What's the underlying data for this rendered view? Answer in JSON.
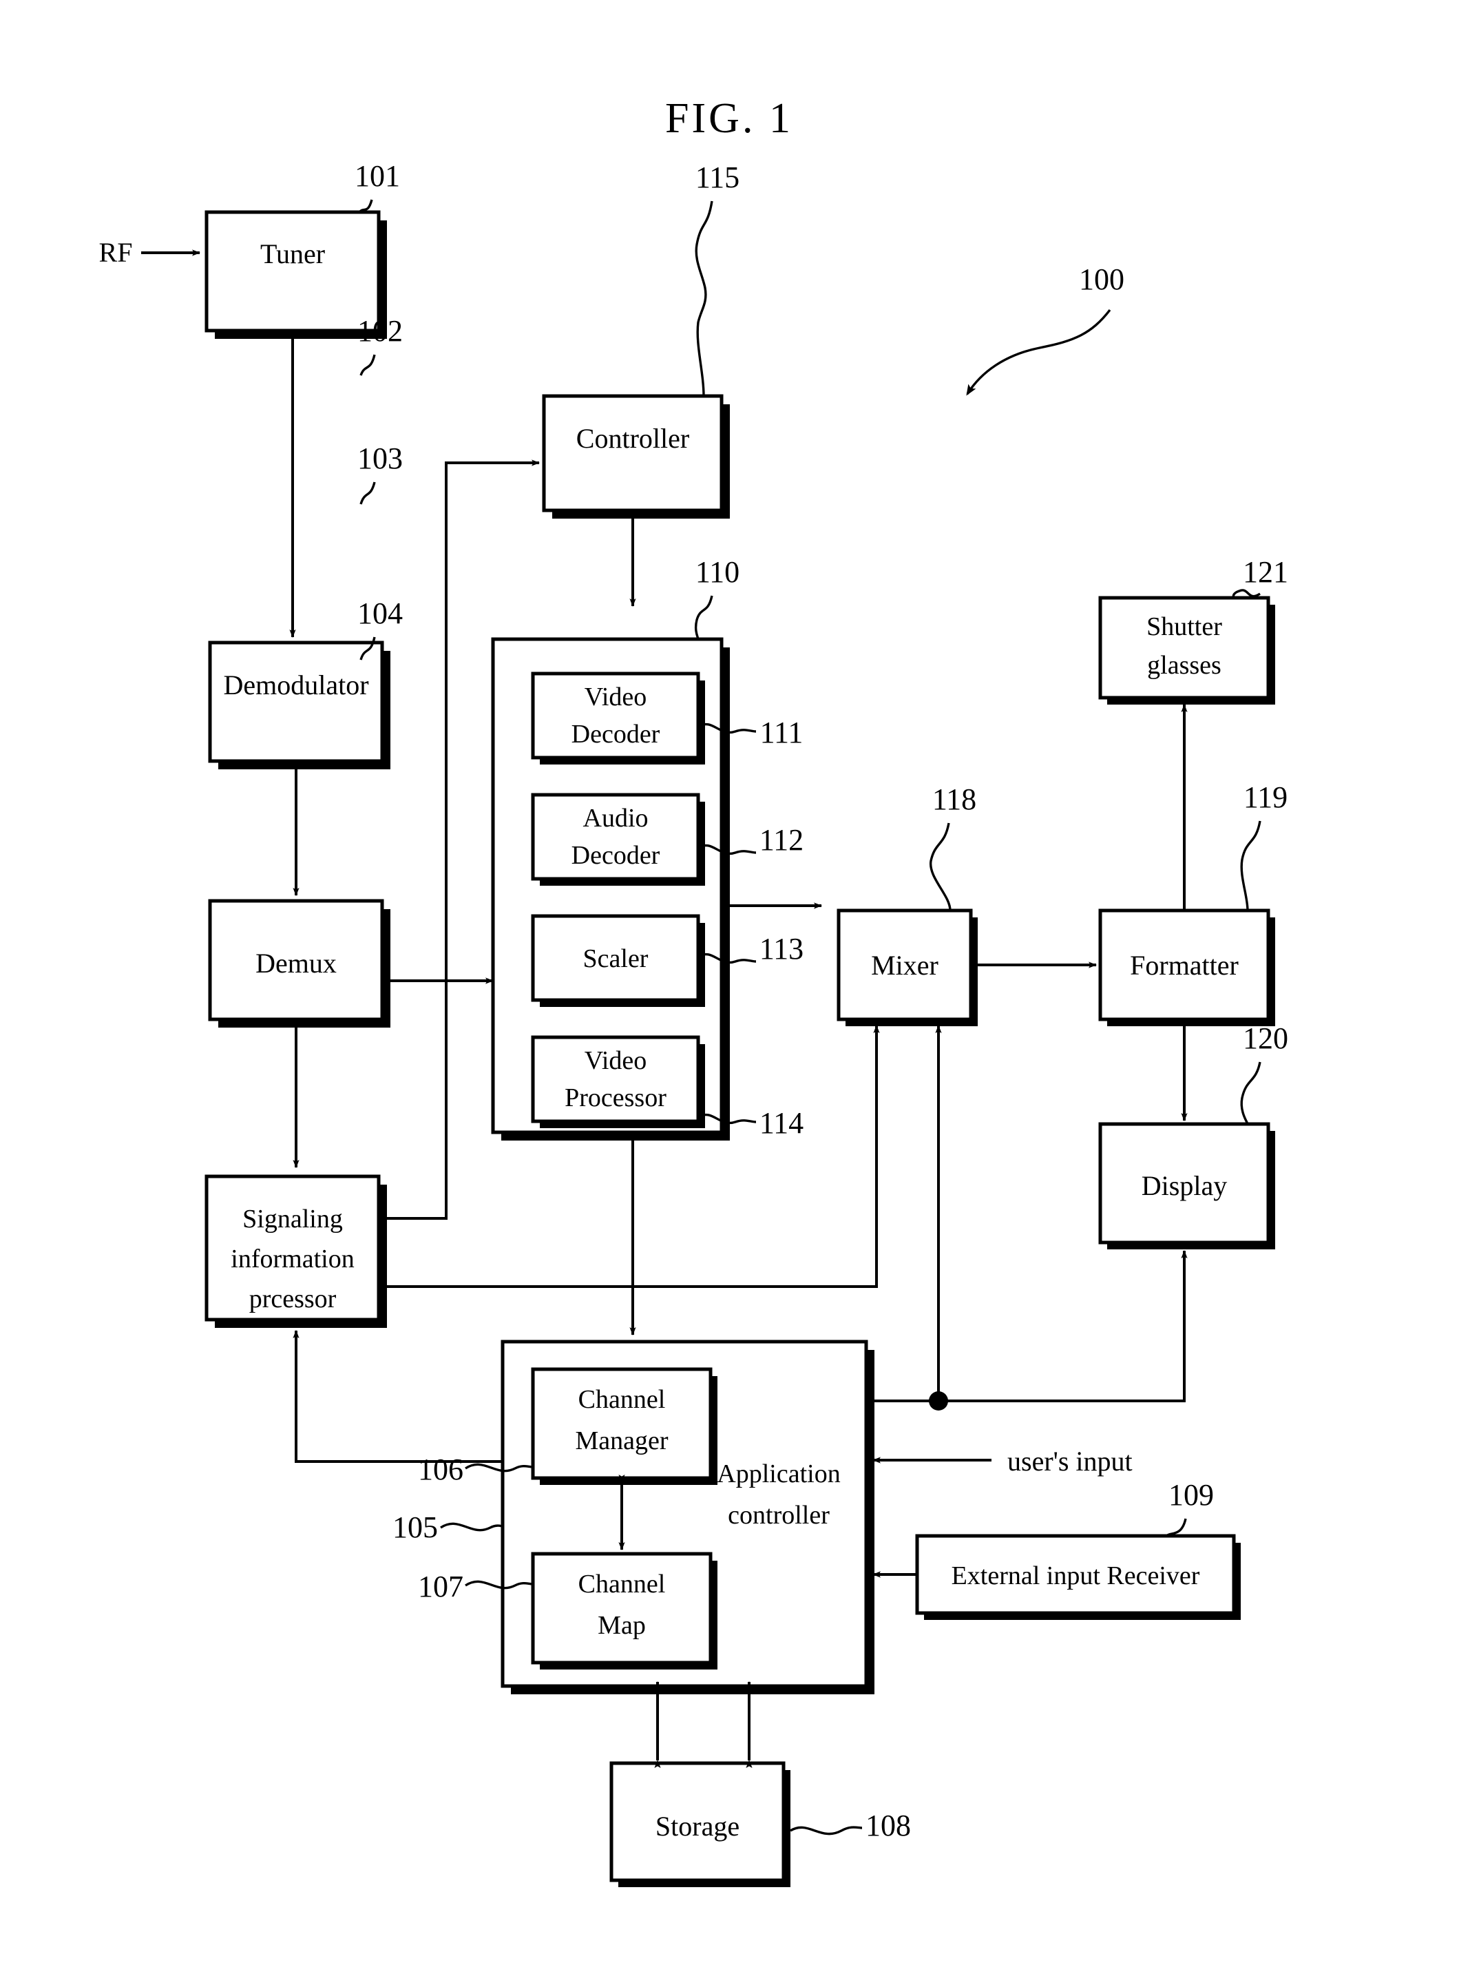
{
  "figure": {
    "title": "FIG. 1",
    "system_ref": "100"
  },
  "signals": {
    "rf_input": "RF",
    "user_input": "user's input"
  },
  "blocks": [
    {
      "id": "tuner",
      "label": "Tuner",
      "ref": "101"
    },
    {
      "id": "demodulator",
      "label": "Demodulator",
      "ref": "102"
    },
    {
      "id": "demux",
      "label": "Demux",
      "ref": "103"
    },
    {
      "id": "signaling",
      "label": "Signaling\ninformation\nprcessor",
      "ref": "104",
      "lines": [
        "Signaling",
        "information",
        "prcessor"
      ]
    },
    {
      "id": "controller",
      "label": "Controller",
      "ref": "115"
    },
    {
      "id": "decoder_group",
      "label": "",
      "ref": "110"
    },
    {
      "id": "video_decoder",
      "label": "Video Decoder",
      "ref": "111",
      "lines": [
        "Video",
        "Decoder"
      ]
    },
    {
      "id": "audio_decoder",
      "label": "Audio Decoder",
      "ref": "112",
      "lines": [
        "Audio",
        "Decoder"
      ]
    },
    {
      "id": "scaler",
      "label": "Scaler",
      "ref": "113",
      "lines": [
        "Scaler"
      ]
    },
    {
      "id": "video_processor",
      "label": "Video Processor",
      "ref": "114",
      "lines": [
        "Video",
        "Processor"
      ]
    },
    {
      "id": "mixer",
      "label": "Mixer",
      "ref": "118"
    },
    {
      "id": "formatter",
      "label": "Formatter",
      "ref": "119"
    },
    {
      "id": "shutter",
      "label": "Shutter glasses",
      "ref": "121",
      "lines": [
        "Shutter",
        "glasses"
      ]
    },
    {
      "id": "display",
      "label": "Display",
      "ref": "120"
    },
    {
      "id": "app_controller",
      "label": "Application controller",
      "ref": "105",
      "lines": [
        "Application",
        "controller"
      ]
    },
    {
      "id": "channel_manager",
      "label": "Channel Manager",
      "ref": "106",
      "lines": [
        "Channel",
        "Manager"
      ]
    },
    {
      "id": "channel_map",
      "label": "Channel Map",
      "ref": "107",
      "lines": [
        "Channel",
        "Map"
      ]
    },
    {
      "id": "storage",
      "label": "Storage",
      "ref": "108"
    },
    {
      "id": "ext_input",
      "label": "External input Receiver",
      "ref": "109"
    }
  ],
  "text": {
    "tuner": "Tuner",
    "demodulator": "Demodulator",
    "demux": "Demux",
    "signaling_l1": "Signaling",
    "signaling_l2": "information",
    "signaling_l3": "prcessor",
    "controller": "Controller",
    "video_decoder_l1": "Video",
    "video_decoder_l2": "Decoder",
    "audio_decoder_l1": "Audio",
    "audio_decoder_l2": "Decoder",
    "scaler": "Scaler",
    "video_processor_l1": "Video",
    "video_processor_l2": "Processor",
    "mixer": "Mixer",
    "formatter": "Formatter",
    "shutter_l1": "Shutter",
    "shutter_l2": "glasses",
    "display": "Display",
    "app_controller_l1": "Application",
    "app_controller_l2": "controller",
    "channel_manager_l1": "Channel",
    "channel_manager_l2": "Manager",
    "channel_map_l1": "Channel",
    "channel_map_l2": "Map",
    "storage": "Storage",
    "ext_input": "External input Receiver"
  },
  "refs": {
    "r100": "100",
    "r101": "101",
    "r102": "102",
    "r103": "103",
    "r104": "104",
    "r105": "105",
    "r106": "106",
    "r107": "107",
    "r108": "108",
    "r109": "109",
    "r110": "110",
    "r111": "111",
    "r112": "112",
    "r113": "113",
    "r114": "114",
    "r115": "115",
    "r118": "118",
    "r119": "119",
    "r120": "120",
    "r121": "121"
  },
  "colors": {
    "ink": "#000000",
    "paper": "#ffffff"
  }
}
